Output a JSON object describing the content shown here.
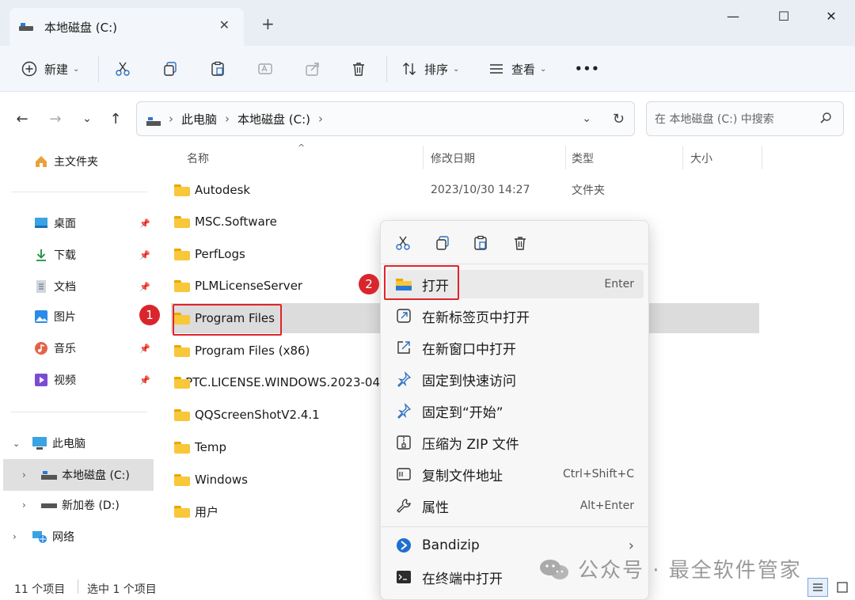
{
  "window": {
    "tab_title": "本地磁盘 (C:)",
    "close_tab": "✕",
    "new_tab": "+",
    "minimize": "—",
    "maximize": "☐",
    "close": "✕"
  },
  "toolbar": {
    "new_label": "新建",
    "sort_label": "排序",
    "view_label": "查看",
    "more_label": "•••"
  },
  "address": {
    "crumbs": [
      "此电脑",
      "本地磁盘 (C:)"
    ],
    "search_placeholder": "在 本地磁盘 (C:) 中搜索"
  },
  "sidebar": {
    "home": "主文件夹",
    "quick": [
      {
        "label": "桌面",
        "icon": "desktop-icon"
      },
      {
        "label": "下载",
        "icon": "download-icon"
      },
      {
        "label": "文档",
        "icon": "document-icon"
      },
      {
        "label": "图片",
        "icon": "pictures-icon"
      },
      {
        "label": "音乐",
        "icon": "music-icon"
      },
      {
        "label": "视频",
        "icon": "video-icon"
      }
    ],
    "this_pc": "此电脑",
    "drives": [
      "本地磁盘 (C:)",
      "新加卷 (D:)"
    ],
    "network": "网络"
  },
  "columns": {
    "name": "名称",
    "modified": "修改日期",
    "type": "类型",
    "size": "大小"
  },
  "files": [
    {
      "name": "Autodesk",
      "date": "2023/10/30 14:27",
      "type": "文件夹"
    },
    {
      "name": "MSC.Software"
    },
    {
      "name": "PerfLogs"
    },
    {
      "name": "PLMLicenseServer"
    },
    {
      "name": "Program Files"
    },
    {
      "name": "Program Files (x86)"
    },
    {
      "name": "PTC.LICENSE.WINDOWS.2023-04"
    },
    {
      "name": "QQScreenShotV2.4.1"
    },
    {
      "name": "Temp"
    },
    {
      "name": "Windows"
    },
    {
      "name": "用户"
    }
  ],
  "context_menu": {
    "items": [
      {
        "label": "打开",
        "shortcut": "Enter",
        "icon": "folder-open-icon"
      },
      {
        "label": "在新标签页中打开",
        "shortcut": "",
        "icon": "open-new-tab-icon"
      },
      {
        "label": "在新窗口中打开",
        "shortcut": "",
        "icon": "open-new-window-icon"
      },
      {
        "label": "固定到快速访问",
        "shortcut": "",
        "icon": "pin-icon"
      },
      {
        "label": "固定到“开始”",
        "shortcut": "",
        "icon": "pin-start-icon"
      },
      {
        "label": "压缩为 ZIP 文件",
        "shortcut": "",
        "icon": "zip-icon"
      },
      {
        "label": "复制文件地址",
        "shortcut": "Ctrl+Shift+C",
        "icon": "copy-path-icon"
      },
      {
        "label": "属性",
        "shortcut": "Alt+Enter",
        "icon": "wrench-icon"
      }
    ],
    "bandizip": "Bandizip",
    "terminal": "在终端中打开"
  },
  "annotations": {
    "badge1": "1",
    "badge2": "2"
  },
  "status": {
    "count": "11 个项目",
    "selected": "选中 1 个项目"
  },
  "watermark": "公众号 · 最全软件管家"
}
